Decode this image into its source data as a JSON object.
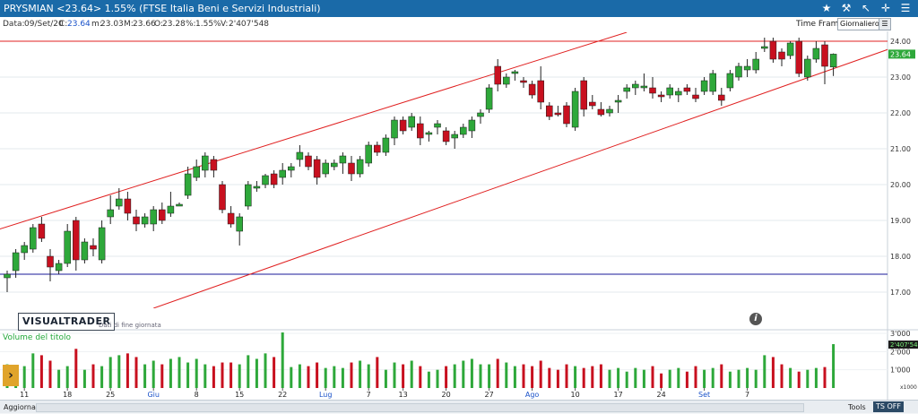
{
  "window": {
    "title": "PRYSMIAN <23.64> 1.55%  (FTSE Italia Beni e Servizi Industriali)"
  },
  "info": {
    "date_label": "Data:",
    "date": "09/Set/20",
    "close_label": "C:",
    "close": "23.64",
    "low_label": "m:",
    "low": "23.03",
    "high_label": "M:",
    "high": "23.66",
    "open_label": "O:",
    "open": "23.28",
    "change_label": "%:",
    "change": "1.55%",
    "volume_label": "V:",
    "volume": "2'407'548"
  },
  "timeframe": {
    "label": "Time Frame",
    "value": "Giornaliero"
  },
  "logo": {
    "name": "VISUALTRADER",
    "subtitle": "Dati di fine giornata"
  },
  "volume_panel": {
    "label": "Volume del titolo",
    "last_value": "2'407'54",
    "multiplier": "x1000"
  },
  "bottom": {
    "update": "Aggiorna",
    "tools": "Tools",
    "ts": "TS OFF"
  },
  "colors": {
    "up": "#2ea83a",
    "down": "#c8101f",
    "channel": "#e02020",
    "support": "#1a1a9a",
    "accent": "#1a6aa8"
  },
  "icons": [
    "star-icon",
    "hammer-icon",
    "cursor-icon",
    "crosshair-icon",
    "menu-icon"
  ],
  "chart_data": {
    "type": "candlestick",
    "price_axis": {
      "ylim": [
        16.55,
        24.25
      ],
      "ticks": [
        17,
        18,
        19,
        20,
        21,
        22,
        23,
        24
      ],
      "tick_labels": [
        "17.00",
        "18.00",
        "19.00",
        "20.00",
        "21.00",
        "22.00",
        "23.00",
        "24.00"
      ]
    },
    "last_price_label": "23.64",
    "volume_axis": {
      "ylim": [
        0,
        3000
      ],
      "ticks": [
        1000,
        2000,
        3000
      ],
      "tick_labels": [
        "1'000",
        "2'000",
        "3'000"
      ]
    },
    "date_labels": [
      {
        "label": "11",
        "index": 2
      },
      {
        "label": "18",
        "index": 7
      },
      {
        "label": "25",
        "index": 12
      },
      {
        "label": "Giu",
        "index": 17
      },
      {
        "label": "8",
        "index": 22
      },
      {
        "label": "15",
        "index": 27
      },
      {
        "label": "22",
        "index": 32
      },
      {
        "label": "Lug",
        "index": 37
      },
      {
        "label": "7",
        "index": 42
      },
      {
        "label": "13",
        "index": 46
      },
      {
        "label": "20",
        "index": 51
      },
      {
        "label": "27",
        "index": 56
      },
      {
        "label": "Ago",
        "index": 61
      },
      {
        "label": "10",
        "index": 66
      },
      {
        "label": "17",
        "index": 71
      },
      {
        "label": "24",
        "index": 76
      },
      {
        "label": "Set",
        "index": 81
      },
      {
        "label": "7",
        "index": 86
      }
    ],
    "candles": [
      {
        "o": 17.4,
        "h": 17.6,
        "l": 17.0,
        "c": 17.5,
        "v": 1300
      },
      {
        "o": 17.6,
        "h": 18.2,
        "l": 17.4,
        "c": 18.1,
        "v": 1100
      },
      {
        "o": 18.1,
        "h": 18.4,
        "l": 17.9,
        "c": 18.3,
        "v": 1200
      },
      {
        "o": 18.2,
        "h": 18.9,
        "l": 18.1,
        "c": 18.8,
        "v": 1900
      },
      {
        "o": 18.9,
        "h": 19.1,
        "l": 18.4,
        "c": 18.5,
        "v": 1800
      },
      {
        "o": 18.0,
        "h": 18.2,
        "l": 17.3,
        "c": 17.7,
        "v": 1500
      },
      {
        "o": 17.6,
        "h": 17.9,
        "l": 17.5,
        "c": 17.8,
        "v": 1000
      },
      {
        "o": 17.8,
        "h": 18.9,
        "l": 17.7,
        "c": 18.7,
        "v": 1200
      },
      {
        "o": 19.0,
        "h": 19.1,
        "l": 17.6,
        "c": 17.9,
        "v": 2150
      },
      {
        "o": 17.9,
        "h": 18.5,
        "l": 17.8,
        "c": 18.4,
        "v": 1000
      },
      {
        "o": 18.3,
        "h": 18.5,
        "l": 18.0,
        "c": 18.2,
        "v": 1300
      },
      {
        "o": 17.9,
        "h": 19.0,
        "l": 17.8,
        "c": 18.8,
        "v": 1200
      },
      {
        "o": 19.1,
        "h": 19.7,
        "l": 18.9,
        "c": 19.3,
        "v": 1700
      },
      {
        "o": 19.4,
        "h": 19.9,
        "l": 19.3,
        "c": 19.6,
        "v": 1800
      },
      {
        "o": 19.6,
        "h": 19.8,
        "l": 19.0,
        "c": 19.2,
        "v": 1900
      },
      {
        "o": 19.1,
        "h": 19.3,
        "l": 18.7,
        "c": 18.9,
        "v": 1700
      },
      {
        "o": 18.9,
        "h": 19.2,
        "l": 18.8,
        "c": 19.1,
        "v": 1300
      },
      {
        "o": 18.9,
        "h": 19.4,
        "l": 18.7,
        "c": 19.3,
        "v": 1500
      },
      {
        "o": 19.3,
        "h": 19.5,
        "l": 18.9,
        "c": 19.0,
        "v": 1300
      },
      {
        "o": 19.2,
        "h": 19.8,
        "l": 19.1,
        "c": 19.4,
        "v": 1600
      },
      {
        "o": 19.4,
        "h": 19.5,
        "l": 19.4,
        "c": 19.45,
        "v": 1700
      },
      {
        "o": 19.7,
        "h": 20.5,
        "l": 19.6,
        "c": 20.3,
        "v": 1400
      },
      {
        "o": 20.2,
        "h": 20.7,
        "l": 20.1,
        "c": 20.5,
        "v": 1600
      },
      {
        "o": 20.4,
        "h": 20.9,
        "l": 20.2,
        "c": 20.8,
        "v": 1300
      },
      {
        "o": 20.7,
        "h": 20.8,
        "l": 20.2,
        "c": 20.4,
        "v": 1200
      },
      {
        "o": 20.0,
        "h": 20.1,
        "l": 19.2,
        "c": 19.3,
        "v": 1400
      },
      {
        "o": 19.2,
        "h": 19.4,
        "l": 18.8,
        "c": 18.9,
        "v": 1400
      },
      {
        "o": 18.7,
        "h": 19.2,
        "l": 18.3,
        "c": 19.1,
        "v": 1300
      },
      {
        "o": 19.4,
        "h": 20.1,
        "l": 19.3,
        "c": 20.0,
        "v": 1800
      },
      {
        "o": 19.9,
        "h": 20.1,
        "l": 19.8,
        "c": 19.95,
        "v": 1600
      },
      {
        "o": 20.0,
        "h": 20.3,
        "l": 19.9,
        "c": 20.25,
        "v": 1900
      },
      {
        "o": 20.3,
        "h": 20.4,
        "l": 19.9,
        "c": 20.0,
        "v": 1700
      },
      {
        "o": 20.2,
        "h": 20.6,
        "l": 20.0,
        "c": 20.4,
        "v": 3050
      },
      {
        "o": 20.4,
        "h": 20.6,
        "l": 20.2,
        "c": 20.5,
        "v": 1150
      },
      {
        "o": 20.7,
        "h": 21.1,
        "l": 20.5,
        "c": 20.9,
        "v": 1300
      },
      {
        "o": 20.8,
        "h": 20.9,
        "l": 20.4,
        "c": 20.5,
        "v": 1200
      },
      {
        "o": 20.7,
        "h": 20.8,
        "l": 20.0,
        "c": 20.2,
        "v": 1400
      },
      {
        "o": 20.3,
        "h": 20.7,
        "l": 20.2,
        "c": 20.6,
        "v": 1100
      },
      {
        "o": 20.5,
        "h": 20.7,
        "l": 20.4,
        "c": 20.6,
        "v": 1200
      },
      {
        "o": 20.6,
        "h": 20.9,
        "l": 20.3,
        "c": 20.8,
        "v": 1100
      },
      {
        "o": 20.6,
        "h": 20.8,
        "l": 20.1,
        "c": 20.3,
        "v": 1400
      },
      {
        "o": 20.3,
        "h": 20.8,
        "l": 20.2,
        "c": 20.7,
        "v": 1500
      },
      {
        "o": 20.6,
        "h": 21.2,
        "l": 20.5,
        "c": 21.1,
        "v": 1300
      },
      {
        "o": 21.1,
        "h": 21.2,
        "l": 20.8,
        "c": 20.9,
        "v": 1700
      },
      {
        "o": 20.9,
        "h": 21.4,
        "l": 20.8,
        "c": 21.3,
        "v": 1000
      },
      {
        "o": 21.3,
        "h": 21.9,
        "l": 21.1,
        "c": 21.8,
        "v": 1400
      },
      {
        "o": 21.8,
        "h": 21.9,
        "l": 21.4,
        "c": 21.5,
        "v": 1300
      },
      {
        "o": 21.6,
        "h": 22.0,
        "l": 21.5,
        "c": 21.9,
        "v": 1500
      },
      {
        "o": 21.7,
        "h": 21.9,
        "l": 21.1,
        "c": 21.3,
        "v": 1200
      },
      {
        "o": 21.4,
        "h": 21.5,
        "l": 21.2,
        "c": 21.45,
        "v": 900
      },
      {
        "o": 21.6,
        "h": 21.8,
        "l": 21.4,
        "c": 21.7,
        "v": 1000
      },
      {
        "o": 21.5,
        "h": 21.6,
        "l": 21.1,
        "c": 21.2,
        "v": 1200
      },
      {
        "o": 21.3,
        "h": 21.5,
        "l": 21.0,
        "c": 21.4,
        "v": 1300
      },
      {
        "o": 21.4,
        "h": 21.7,
        "l": 21.3,
        "c": 21.6,
        "v": 1500
      },
      {
        "o": 21.5,
        "h": 21.9,
        "l": 21.3,
        "c": 21.8,
        "v": 1600
      },
      {
        "o": 21.9,
        "h": 22.1,
        "l": 21.7,
        "c": 22.0,
        "v": 1300
      },
      {
        "o": 22.1,
        "h": 22.8,
        "l": 22.0,
        "c": 22.7,
        "v": 1300
      },
      {
        "o": 23.3,
        "h": 23.5,
        "l": 22.6,
        "c": 22.8,
        "v": 1600
      },
      {
        "o": 22.8,
        "h": 23.1,
        "l": 22.7,
        "c": 23.0,
        "v": 1400
      },
      {
        "o": 23.1,
        "h": 23.2,
        "l": 22.9,
        "c": 23.15,
        "v": 1200
      },
      {
        "o": 22.9,
        "h": 23.0,
        "l": 22.7,
        "c": 22.85,
        "v": 1300
      },
      {
        "o": 22.8,
        "h": 22.9,
        "l": 22.4,
        "c": 22.5,
        "v": 1200
      },
      {
        "o": 22.9,
        "h": 23.3,
        "l": 22.1,
        "c": 22.3,
        "v": 1500
      },
      {
        "o": 22.2,
        "h": 22.3,
        "l": 21.8,
        "c": 21.9,
        "v": 1100
      },
      {
        "o": 22.0,
        "h": 22.2,
        "l": 21.9,
        "c": 21.95,
        "v": 1000
      },
      {
        "o": 22.2,
        "h": 22.3,
        "l": 21.6,
        "c": 21.7,
        "v": 1300
      },
      {
        "o": 21.6,
        "h": 22.7,
        "l": 21.5,
        "c": 22.6,
        "v": 1200
      },
      {
        "o": 22.9,
        "h": 23.0,
        "l": 21.9,
        "c": 22.1,
        "v": 1100
      },
      {
        "o": 22.3,
        "h": 22.5,
        "l": 22.1,
        "c": 22.2,
        "v": 1200
      },
      {
        "o": 22.1,
        "h": 22.3,
        "l": 21.9,
        "c": 21.95,
        "v": 1300
      },
      {
        "o": 22.0,
        "h": 22.2,
        "l": 21.9,
        "c": 22.1,
        "v": 1000
      },
      {
        "o": 22.3,
        "h": 22.5,
        "l": 22.0,
        "c": 22.35,
        "v": 1100
      },
      {
        "o": 22.6,
        "h": 22.8,
        "l": 22.4,
        "c": 22.7,
        "v": 900
      },
      {
        "o": 22.7,
        "h": 22.9,
        "l": 22.5,
        "c": 22.8,
        "v": 1100
      },
      {
        "o": 22.7,
        "h": 23.1,
        "l": 22.6,
        "c": 22.75,
        "v": 1000
      },
      {
        "o": 22.7,
        "h": 23.0,
        "l": 22.4,
        "c": 22.55,
        "v": 1200
      },
      {
        "o": 22.5,
        "h": 22.6,
        "l": 22.3,
        "c": 22.45,
        "v": 800
      },
      {
        "o": 22.5,
        "h": 22.8,
        "l": 22.4,
        "c": 22.7,
        "v": 1000
      },
      {
        "o": 22.5,
        "h": 22.7,
        "l": 22.3,
        "c": 22.6,
        "v": 1100
      },
      {
        "o": 22.7,
        "h": 22.8,
        "l": 22.5,
        "c": 22.6,
        "v": 900
      },
      {
        "o": 22.5,
        "h": 22.7,
        "l": 22.3,
        "c": 22.4,
        "v": 1200
      },
      {
        "o": 22.6,
        "h": 23.0,
        "l": 22.5,
        "c": 22.9,
        "v": 1000
      },
      {
        "o": 22.6,
        "h": 23.2,
        "l": 22.5,
        "c": 23.1,
        "v": 1100
      },
      {
        "o": 22.5,
        "h": 22.7,
        "l": 22.2,
        "c": 22.35,
        "v": 1300
      },
      {
        "o": 22.7,
        "h": 23.2,
        "l": 22.6,
        "c": 23.1,
        "v": 900
      },
      {
        "o": 23.0,
        "h": 23.4,
        "l": 22.9,
        "c": 23.3,
        "v": 1000
      },
      {
        "o": 23.2,
        "h": 23.5,
        "l": 23.0,
        "c": 23.3,
        "v": 1100
      },
      {
        "o": 23.2,
        "h": 23.7,
        "l": 23.1,
        "c": 23.5,
        "v": 1000
      },
      {
        "o": 23.8,
        "h": 24.1,
        "l": 23.7,
        "c": 23.85,
        "v": 1800
      },
      {
        "o": 24.0,
        "h": 24.1,
        "l": 23.4,
        "c": 23.5,
        "v": 1700
      },
      {
        "o": 23.7,
        "h": 23.8,
        "l": 23.3,
        "c": 23.5,
        "v": 1300
      },
      {
        "o": 23.6,
        "h": 24.0,
        "l": 23.5,
        "c": 23.95,
        "v": 1100
      },
      {
        "o": 24.0,
        "h": 24.1,
        "l": 23.0,
        "c": 23.1,
        "v": 900
      },
      {
        "o": 23.0,
        "h": 23.6,
        "l": 22.9,
        "c": 23.5,
        "v": 1000
      },
      {
        "o": 23.5,
        "h": 24.0,
        "l": 23.4,
        "c": 23.8,
        "v": 1100
      },
      {
        "o": 23.9,
        "h": 24.0,
        "l": 22.8,
        "c": 23.3,
        "v": 1150
      },
      {
        "o": 23.28,
        "h": 23.66,
        "l": 23.03,
        "c": 23.64,
        "v": 2408
      }
    ],
    "channel_lines": [
      {
        "from": {
          "index": -1,
          "price": 18.75
        },
        "to": {
          "index": 72,
          "price": 24.25
        }
      },
      {
        "from": {
          "index": 17,
          "price": 16.55
        },
        "to": {
          "index": 108,
          "price": 24.25
        }
      }
    ],
    "horizontal_lines": [
      {
        "price": 24.0,
        "color": "#e02020"
      },
      {
        "price": 17.5,
        "color": "#1a1a9a"
      }
    ]
  }
}
